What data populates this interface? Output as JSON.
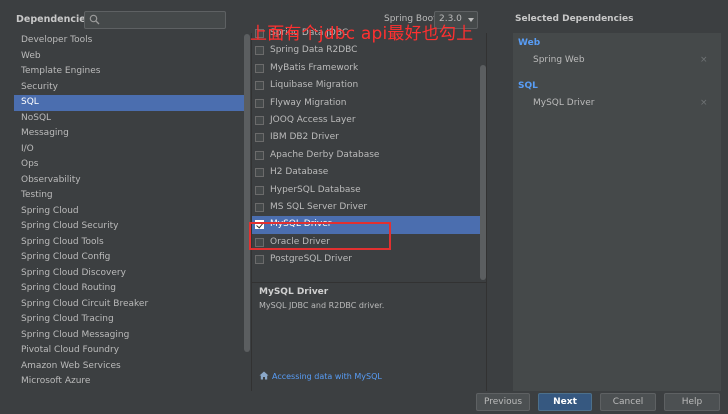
{
  "header": {
    "dependencies_title": "Dependencies",
    "search_placeholder": "",
    "spring_boot_label": "Spring Boot :",
    "spring_boot_version": "2.3.0"
  },
  "categories": [
    {
      "label": "Developer Tools",
      "selected": false
    },
    {
      "label": "Web",
      "selected": false
    },
    {
      "label": "Template Engines",
      "selected": false
    },
    {
      "label": "Security",
      "selected": false
    },
    {
      "label": "SQL",
      "selected": true
    },
    {
      "label": "NoSQL",
      "selected": false
    },
    {
      "label": "Messaging",
      "selected": false
    },
    {
      "label": "I/O",
      "selected": false
    },
    {
      "label": "Ops",
      "selected": false
    },
    {
      "label": "Observability",
      "selected": false
    },
    {
      "label": "Testing",
      "selected": false
    },
    {
      "label": "Spring Cloud",
      "selected": false
    },
    {
      "label": "Spring Cloud Security",
      "selected": false
    },
    {
      "label": "Spring Cloud Tools",
      "selected": false
    },
    {
      "label": "Spring Cloud Config",
      "selected": false
    },
    {
      "label": "Spring Cloud Discovery",
      "selected": false
    },
    {
      "label": "Spring Cloud Routing",
      "selected": false
    },
    {
      "label": "Spring Cloud Circuit Breaker",
      "selected": false
    },
    {
      "label": "Spring Cloud Tracing",
      "selected": false
    },
    {
      "label": "Spring Cloud Messaging",
      "selected": false
    },
    {
      "label": "Pivotal Cloud Foundry",
      "selected": false
    },
    {
      "label": "Amazon Web Services",
      "selected": false
    },
    {
      "label": "Microsoft Azure",
      "selected": false
    }
  ],
  "dependencies": [
    {
      "label": "Spring Data JDBC",
      "checked": false
    },
    {
      "label": "Spring Data R2DBC",
      "checked": false
    },
    {
      "label": "MyBatis Framework",
      "checked": false
    },
    {
      "label": "Liquibase Migration",
      "checked": false
    },
    {
      "label": "Flyway Migration",
      "checked": false
    },
    {
      "label": "JOOQ Access Layer",
      "checked": false
    },
    {
      "label": "IBM DB2 Driver",
      "checked": false
    },
    {
      "label": "Apache Derby Database",
      "checked": false
    },
    {
      "label": "H2 Database",
      "checked": false
    },
    {
      "label": "HyperSQL Database",
      "checked": false
    },
    {
      "label": "MS SQL Server Driver",
      "checked": false
    },
    {
      "label": "MySQL Driver",
      "checked": true
    },
    {
      "label": "Oracle Driver",
      "checked": false
    },
    {
      "label": "PostgreSQL Driver",
      "checked": false
    }
  ],
  "detail": {
    "name": "MySQL Driver",
    "description": "MySQL JDBC and R2DBC driver.",
    "link": "Accessing data with MySQL"
  },
  "selected_panel": {
    "title": "Selected Dependencies",
    "groups": [
      {
        "name": "Web",
        "items": [
          "Spring Web"
        ]
      },
      {
        "name": "SQL",
        "items": [
          "MySQL Driver"
        ]
      }
    ],
    "remove_glyph": "×"
  },
  "annotation": {
    "text": "上面有个jdbc api最好也勾上",
    "color": "#ff3030"
  },
  "buttons": {
    "previous": "Previous",
    "next": "Next",
    "cancel": "Cancel",
    "help": "Help"
  },
  "colors": {
    "selection": "#4b6eaf",
    "accent_link": "#589df6",
    "primary_button": "#365880"
  }
}
